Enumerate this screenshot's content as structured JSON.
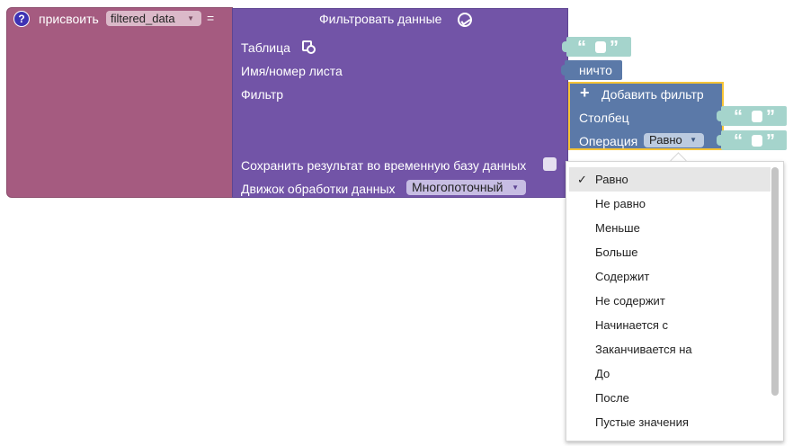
{
  "assign_block": {
    "help_icon": "?",
    "label": "присвоить",
    "variable": "filtered_data",
    "equals": "="
  },
  "filter_block": {
    "title": "Фильтровать данные",
    "title_icon": "chart-icon",
    "table_label": "Таблица",
    "sheet_label": "Имя/номер листа",
    "sheet_value": "ничто",
    "filter_label": "Фильтр",
    "save_label": "Сохранить результат во временную базу данных",
    "engine_label": "Движок обработки данных",
    "engine_value": "Многопоточный"
  },
  "filter_sub_block": {
    "add_filter": "Добавить фильтр",
    "column_label": "Столбец",
    "operation_label": "Операция",
    "operation_value": "Равно"
  },
  "quote_open": "“",
  "quote_close": "”",
  "dropdown": {
    "selected_index": 0,
    "check": "✓",
    "options": [
      "Равно",
      "Не равно",
      "Меньше",
      "Больше",
      "Содержит",
      "Не содержит",
      "Начинается с",
      "Заканчивается на",
      "До",
      "После",
      "Пустые значения"
    ]
  },
  "colors": {
    "assign_block": "#a55b80",
    "filter_block": "#7254a7",
    "sub_block": "#5b79a8",
    "selection_outline": "#f6c437",
    "text_plug": "#a5d4cc"
  }
}
